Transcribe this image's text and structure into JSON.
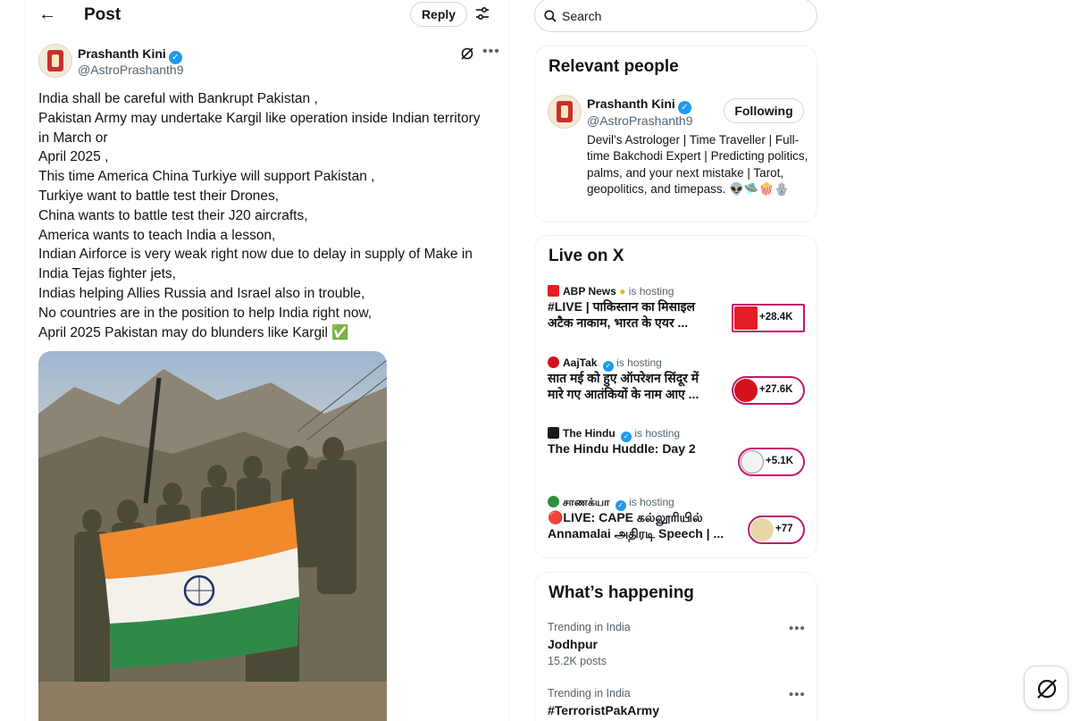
{
  "header": {
    "title": "Post",
    "reply_label": "Reply"
  },
  "post": {
    "author_name": "Prashanth Kini",
    "author_handle": "@AstroPrashanth9",
    "lines": [
      "India shall be careful with Bankrupt Pakistan ,",
      "Pakistan Army may undertake Kargil like operation inside Indian territory",
      "in March or",
      "April 2025 ,",
      "This time America China Turkiye will support Pakistan ,",
      "Turkiye want to battle test their Drones,",
      "China wants to battle test their J20 aircrafts,",
      "America wants to teach India a lesson,",
      "Indian Airforce is very weak right now due to delay in supply of Make in",
      "India Tejas fighter jets,",
      "Indias helping Allies Russia and Israel also in trouble,",
      "No countries are in the position to help India right now,",
      "April 2025 Pakistan may do blunders like Kargil ✅"
    ]
  },
  "search": {
    "placeholder": "Search"
  },
  "relevant_people": {
    "title": "Relevant people",
    "name": "Prashanth Kini",
    "handle": "@AstroPrashanth9",
    "follow_label": "Following",
    "bio": "Devil’s Astrologer | Time Traveller | Full-time Bakchodi Expert | Predicting politics, palms, and your next mistake | Tarot, geopolitics, and timepass. 👽🛸🍿🪬"
  },
  "live": {
    "title": "Live on X",
    "hosting_label": "is hosting",
    "items": [
      {
        "host": "ABP News",
        "title_1": "#LIVE | पाकिस्तान का मिसाइल",
        "title_2": "अटैक नाकाम, भारत के एयर ...",
        "count": "+28.4K",
        "logo_color": "#e31e24"
      },
      {
        "host": "AajTak",
        "title_1": "सात मई को हुए ऑपरेशन सिंदूर में",
        "title_2": "मारे गए आतंकियों के नाम आए ...",
        "count": "+27.6K",
        "logo_color": "#d3131b"
      },
      {
        "host": "The Hindu",
        "title_1": "The Hindu Huddle: Day 2",
        "title_2": "",
        "count": "+5.1K",
        "logo_color": "#1a1a1a"
      },
      {
        "host": "சாணக்யா",
        "title_1": "🔴LIVE: CAPE கல்லூரியில்",
        "title_2": "Annamalai அதிரடி Speech | ...",
        "count": "+77",
        "logo_color": "#2f8f3a"
      }
    ]
  },
  "happening": {
    "title": "What’s happening",
    "trends": [
      {
        "context": "Trending in India",
        "name": "Jodhpur",
        "count": "15.2K posts"
      },
      {
        "context": "Trending in India",
        "name": "#TerroristPakArmy",
        "count": ""
      }
    ]
  }
}
